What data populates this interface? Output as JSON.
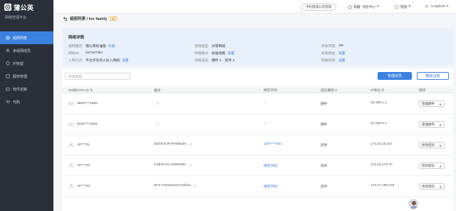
{
  "app": {
    "brand": "蒲公英",
    "subtitle": "网络管理平台"
  },
  "sidebar": {
    "items": [
      {
        "label": "组网列表",
        "icon": "network-icon",
        "active": true
      },
      {
        "label": "未组网成员",
        "icon": "member-icon",
        "active": false
      },
      {
        "label": "IP管理",
        "icon": "ip-icon",
        "active": false
      },
      {
        "label": "服务管理",
        "icon": "service-icon",
        "active": false
      },
      {
        "label": "软件定制",
        "icon": "custom-icon",
        "active": false
      },
      {
        "label": "代购",
        "icon": "cart-icon",
        "active": false
      }
    ]
  },
  "topbar": {
    "pill": "手机版蒲公英管理",
    "help": "帮助",
    "messages": "消息中心",
    "account": "链接",
    "user": "Acsight26"
  },
  "crumb": {
    "path": "组网列表 / fox family",
    "badge": "新"
  },
  "detail": {
    "title": "网络详情",
    "fields": {
      "service_k": "组网服务:",
      "service_v": "蒲公英标准版",
      "service_link": "升级",
      "netid_k": "网络ID:",
      "netid_v": "347197364",
      "join_k": "入网方式:",
      "join_v": "不允许任何人加入网络",
      "join_link": "设置",
      "type_k": "组网类型:",
      "type_v": "对等网络",
      "mode_k": "网络模式:",
      "mode_v": "标准线路",
      "mode_link": "设置",
      "members_k": "网络成员:",
      "members_v1": "硬件  2",
      "members_v2": "软件  3",
      "bw_k": "转发带宽:",
      "bw_v": "2M",
      "route_k": "转发路由:",
      "route_link": "设置",
      "res_k": "网络资源:",
      "res_link": "设置"
    }
  },
  "toolbar": {
    "search_placeholder": "快速搜索",
    "primary_label": "管理成员",
    "outline_label": "删除设置"
  },
  "table": {
    "headers": [
      "SN码/VPN ID",
      "备注",
      "绑定手机",
      "成员属性",
      "IP地址",
      "操作"
    ],
    "rows": [
      {
        "device": "router",
        "id": "0993****1693",
        "note": "",
        "phone": "--",
        "type": "硬件",
        "ip": "10.168.1.1",
        "op": "管理硬件"
      },
      {
        "device": "router",
        "id": "8344****1552",
        "note": "",
        "phone": "--",
        "type": "硬件",
        "ip": "10.168.3.1",
        "op": "管理硬件"
      },
      {
        "device": "user",
        "id": "10****01",
        "note": "DESKTOP-9T9ML8H",
        "phone": "138****7941",
        "type": "软件",
        "ip": "172.16.15.167",
        "op": "修改密码"
      },
      {
        "device": "user",
        "id": "10****02",
        "note": "USERCHI-AR8FM2U",
        "phone": "绑定手机",
        "type": "软件",
        "ip": "172.16.179.70",
        "op": "修改密码"
      },
      {
        "device": "user",
        "id": "10****04",
        "note": "Mi 9 Transparent Edition",
        "phone": "绑定手机",
        "type": "软件",
        "ip": "172.27.199.218",
        "op": "修改密码"
      }
    ]
  },
  "colors": {
    "accent": "#3b82e0",
    "sidebar": "#2b2f3a"
  }
}
